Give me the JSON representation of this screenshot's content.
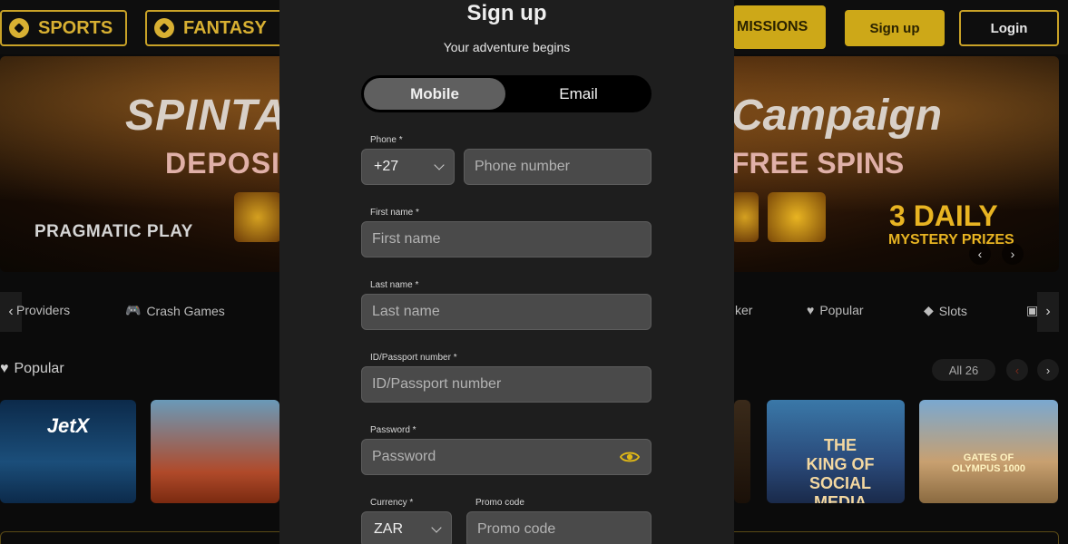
{
  "header": {
    "sports_label": "SPORTS",
    "fantasy_label": "FANTASY",
    "missions_label": "MISSIONS",
    "signup_label": "Sign up",
    "login_label": "Login"
  },
  "banner": {
    "title_left": "SPINTA",
    "title_right": "Campaign",
    "deposit_left": "DEPOSIT",
    "deposit_right": "FREE SPINS",
    "provider": "PRAGMATIC PLAY",
    "daily": "3 DAILY",
    "mystery": "MYSTERY PRIZES"
  },
  "categories": {
    "providers": "Providers",
    "crash_games": "Crash Games",
    "poker": "ker",
    "popular": "Popular",
    "slots": "Slots"
  },
  "section": {
    "title": "Popular",
    "all_label": "All 26"
  },
  "games": {
    "jetx": "JetX",
    "king": "THE KING OF SOCIAL MEDIA",
    "olympus": "GATES OF OLYMPUS 1000"
  },
  "modal": {
    "title": "Sign up",
    "subtitle": "Your adventure begins",
    "tab_mobile": "Mobile",
    "tab_email": "Email",
    "phone_label": "Phone *",
    "phone_code": "+27",
    "phone_placeholder": "Phone number",
    "first_name_label": "First name *",
    "first_name_placeholder": "First name",
    "last_name_label": "Last name *",
    "last_name_placeholder": "Last name",
    "id_label": "ID/Passport number *",
    "id_placeholder": "ID/Passport number",
    "password_label": "Password *",
    "password_placeholder": "Password",
    "currency_label": "Currency *",
    "currency_value": "ZAR",
    "promo_label": "Promo code",
    "promo_placeholder": "Promo code"
  },
  "colors": {
    "accent_gold": "#cda818",
    "modal_bg": "#1e1e1e",
    "field_bg": "#4a4a4a",
    "eye_icon": "#e0b816"
  }
}
